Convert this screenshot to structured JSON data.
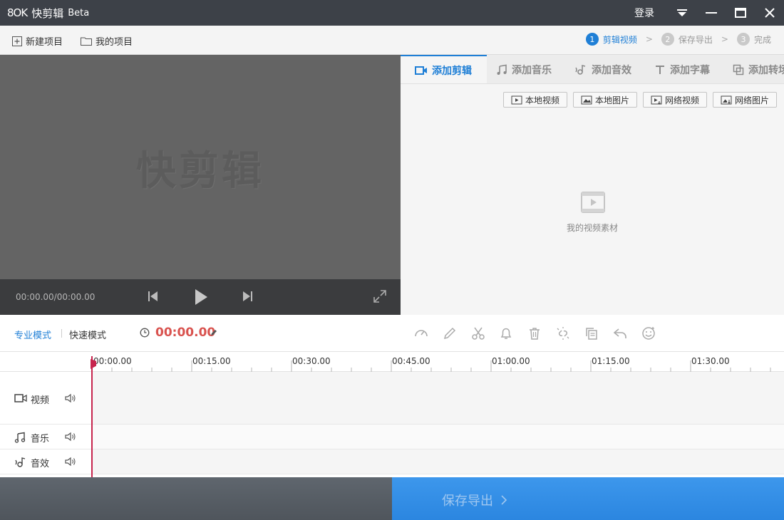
{
  "titlebar": {
    "logo_mark": "8OK",
    "app_name": "快剪辑",
    "beta": "Beta",
    "login": "登录"
  },
  "toolbar": {
    "new_project": "新建项目",
    "my_projects": "我的项目",
    "steps": [
      {
        "num": "1",
        "label": "剪辑视频",
        "active": true
      },
      {
        "num": "2",
        "label": "保存导出",
        "active": false
      },
      {
        "num": "3",
        "label": "完成",
        "active": false
      }
    ],
    "step_separator": ">"
  },
  "preview": {
    "watermark": "快剪辑",
    "timecode": "00:00.00/00:00.00"
  },
  "panel": {
    "tabs": [
      {
        "label": "添加剪辑",
        "icon": "video-camera-icon",
        "active": true
      },
      {
        "label": "添加音乐",
        "icon": "music-note-icon",
        "active": false
      },
      {
        "label": "添加音效",
        "icon": "sound-effect-icon",
        "active": false
      },
      {
        "label": "添加字幕",
        "icon": "text-icon",
        "active": false
      },
      {
        "label": "添加转场",
        "icon": "transition-icon",
        "active": false
      }
    ],
    "source_buttons": [
      "本地视频",
      "本地图片",
      "网络视频",
      "网络图片"
    ],
    "empty_label": "我的视频素材"
  },
  "modebar": {
    "pro_mode": "专业模式",
    "quick_mode": "快速模式",
    "timer": "00:00.00",
    "tools": [
      "speed-icon",
      "pen-icon",
      "scissors-icon",
      "bell-icon",
      "trash-icon",
      "unlink-icon",
      "copy-icon",
      "undo-icon",
      "emoji-icon"
    ]
  },
  "timeline": {
    "ticks": [
      "00:00.00",
      "00:15.00",
      "00:30.00",
      "00:45.00",
      "01:00.00",
      "01:15.00",
      "01:30.00"
    ],
    "tracks": [
      {
        "label": "视频",
        "icon": "video-camera-icon"
      },
      {
        "label": "音乐",
        "icon": "music-note-icon"
      },
      {
        "label": "音效",
        "icon": "sound-effect-icon"
      }
    ]
  },
  "footer": {
    "save_export": "保存导出"
  },
  "colors": {
    "accent": "#1f7fd6",
    "timer": "#d9534f",
    "playhead": "#c7254e",
    "titlebar": "#3d4148"
  }
}
